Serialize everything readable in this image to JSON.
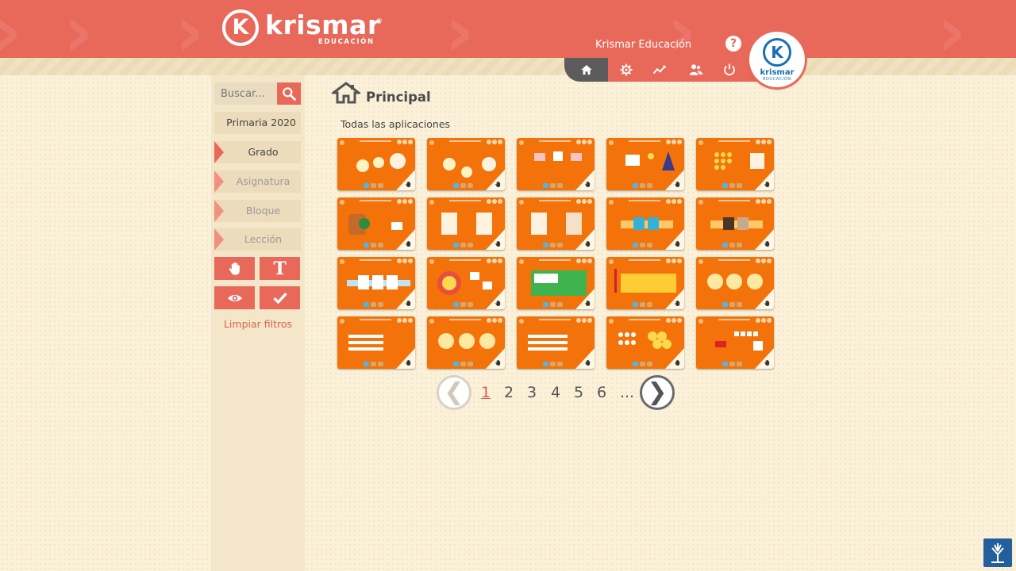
{
  "header": {
    "brand_name": "krismar",
    "brand_sub": "EDUCACIÓN",
    "user_name": "Krismar Educación",
    "help_label": "?",
    "badge_word": "krismar",
    "badge_sub": "EDUCACIÓN",
    "nav": [
      {
        "icon": "home-icon"
      },
      {
        "icon": "gear-icon"
      },
      {
        "icon": "chart-icon"
      },
      {
        "icon": "users-icon"
      },
      {
        "icon": "power-icon"
      }
    ]
  },
  "sidebar": {
    "search_placeholder": "Buscar...",
    "year": "Primaria 2020",
    "filters": [
      {
        "label": "Grado"
      },
      {
        "label": "Asignatura"
      },
      {
        "label": "Bloque"
      },
      {
        "label": "Lección"
      }
    ],
    "tools": [
      {
        "icon": "hand-icon"
      },
      {
        "label": "T",
        "icon": "text-icon"
      },
      {
        "icon": "eye-icon"
      },
      {
        "icon": "check-icon"
      }
    ],
    "clear_filters": "Limpiar filtros"
  },
  "main": {
    "title": "Principal",
    "section_label": "Todas las aplicaciones",
    "card_rows": 4,
    "card_cols": 5
  },
  "pagination": {
    "prev": "❮",
    "next": "❯",
    "pages": [
      "1",
      "2",
      "3",
      "4",
      "5",
      "6"
    ],
    "ellipsis": "...",
    "current": "1"
  },
  "colors": {
    "brand": "#e8685a",
    "card": "#f3720a",
    "background": "#fbf1d9"
  }
}
